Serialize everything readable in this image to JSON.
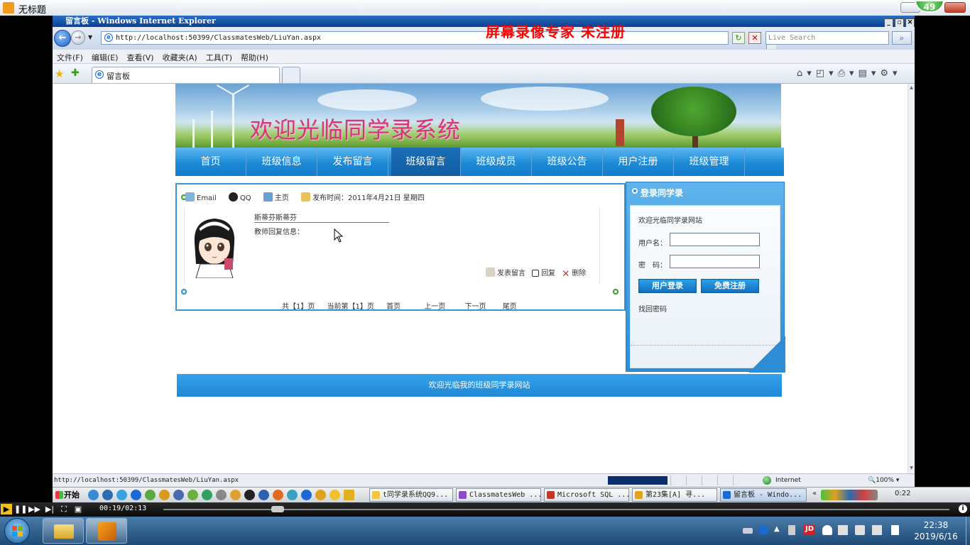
{
  "player": {
    "title": "无标题",
    "badge": "49",
    "time": "00:19/02:13",
    "watermark": "屏幕录像专家  未注册"
  },
  "ie": {
    "window_title": "留言板 - Windows Internet Explorer",
    "address": "http://localhost:50399/ClassmatesWeb/LiuYan.aspx",
    "search_placeholder": "Live Search",
    "menu": [
      "文件(F)",
      "编辑(E)",
      "查看(V)",
      "收藏夹(A)",
      "工具(T)",
      "帮助(H)"
    ],
    "tab_label": "留言板",
    "status_url": "http://localhost:50399/ClassmatesWeb/LiuYan.aspx",
    "status_zone": "Internet",
    "zoom": "100%"
  },
  "page": {
    "banner_title": "欢迎光临同学录系统",
    "nav": [
      "首页",
      "班级信息",
      "发布留言",
      "班级留言",
      "班级成员",
      "班级公告",
      "用户注册",
      "班级管理"
    ],
    "active_nav": "班级留言",
    "message": {
      "email_label": "Email",
      "qq_label": "QQ",
      "home_label": "主页",
      "time_label": "发布时间：2011年4月21日 星期四",
      "content": "斯蒂芬斯蒂芬",
      "teacher_reply": "教师回复信息：",
      "post_label": "发表留言",
      "reply_label": "回复",
      "delete_label": "删除"
    },
    "pager": {
      "total": "共【1】页",
      "current": "当前第【1】页",
      "first": "首页",
      "prev": "上一页",
      "next": "下一页",
      "last": "尾页"
    },
    "login": {
      "title": "登录同学录",
      "welcome": "欢迎光临同学录网站",
      "username_label": "用户名：",
      "password_label": "密　码：",
      "login_button": "用户登录",
      "register_button": "免费注册",
      "forgot": "找回密码"
    },
    "footer": "欢迎光临我的班级同学录网站"
  },
  "taskbar": {
    "start": "开始",
    "tasks": [
      {
        "label": "t同学录系统QQ9...",
        "color": "#f5c342"
      },
      {
        "label": "ClassmatesWeb ...",
        "color": "#8a4bc7"
      },
      {
        "label": "Microsoft SQL ...",
        "color": "#c0392b"
      },
      {
        "label": "第23集[A] 寻...",
        "color": "#e0a21f"
      },
      {
        "label": "留言板 - Windo...",
        "color": "#1c6ad1"
      }
    ],
    "clock": "0:22"
  },
  "system": {
    "time": "22:38",
    "date": "2019/6/16"
  }
}
